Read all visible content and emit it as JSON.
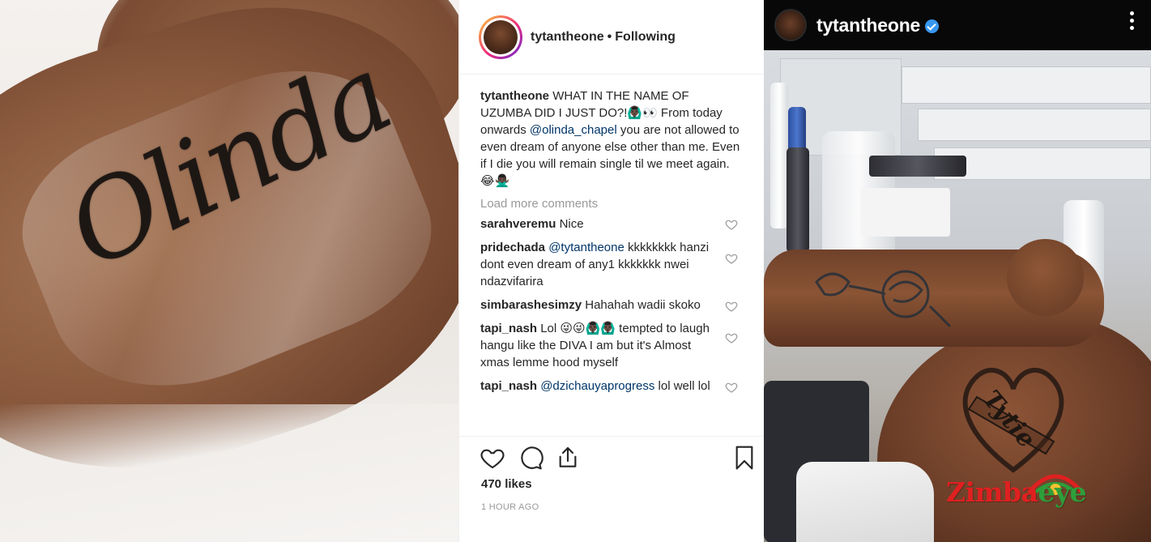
{
  "left_photo": {
    "tattoo_text": "Olinda"
  },
  "instagram_post": {
    "header": {
      "username": "tytantheone",
      "separator": "•",
      "follow_status": "Following"
    },
    "caption": {
      "username": "tytantheone",
      "text_part1": "WHAT IN THE NAME OF UZUMBA DID I JUST DO?!🙆🏿‍♂️👀 From today onwards",
      "mention": "@olinda_chapel",
      "text_part2": "you are not allowed to even dream of anyone else other than me. Even if I die you will remain single til we meet again. 😂🙅🏿‍♂️"
    },
    "load_more": "Load more comments",
    "comments": [
      {
        "username": "sarahveremu",
        "mention": "",
        "text": "Nice"
      },
      {
        "username": "pridechada",
        "mention": "@tytantheone",
        "text": "kkkkkkkk hanzi dont even dream of any1 kkkkkkk nwei ndazvifarira"
      },
      {
        "username": "simbarashesimzy",
        "mention": "",
        "text": "Hahahah wadii skoko"
      },
      {
        "username": "tapi_nash",
        "mention": "",
        "text": "Lol 😜😜🙆🏿‍♂️🙆🏿‍♂️ tempted to laugh hangu like the DIVA I am but it's Almost xmas lemme hood myself"
      },
      {
        "username": "tapi_nash",
        "mention": "@dzichauyaprogress",
        "text": "lol well lol"
      }
    ],
    "likes": "470 likes",
    "time_ago": "1 HOUR AGO"
  },
  "right_photo": {
    "username": "tytantheone",
    "tattoo_text": "Tytie",
    "watermark": {
      "part1": "Zimba",
      "part2": "eye"
    }
  },
  "colors": {
    "mention": "#003569",
    "verified": "#3897f0",
    "watermark_red": "#e02020",
    "watermark_green": "#2e9e3a"
  }
}
